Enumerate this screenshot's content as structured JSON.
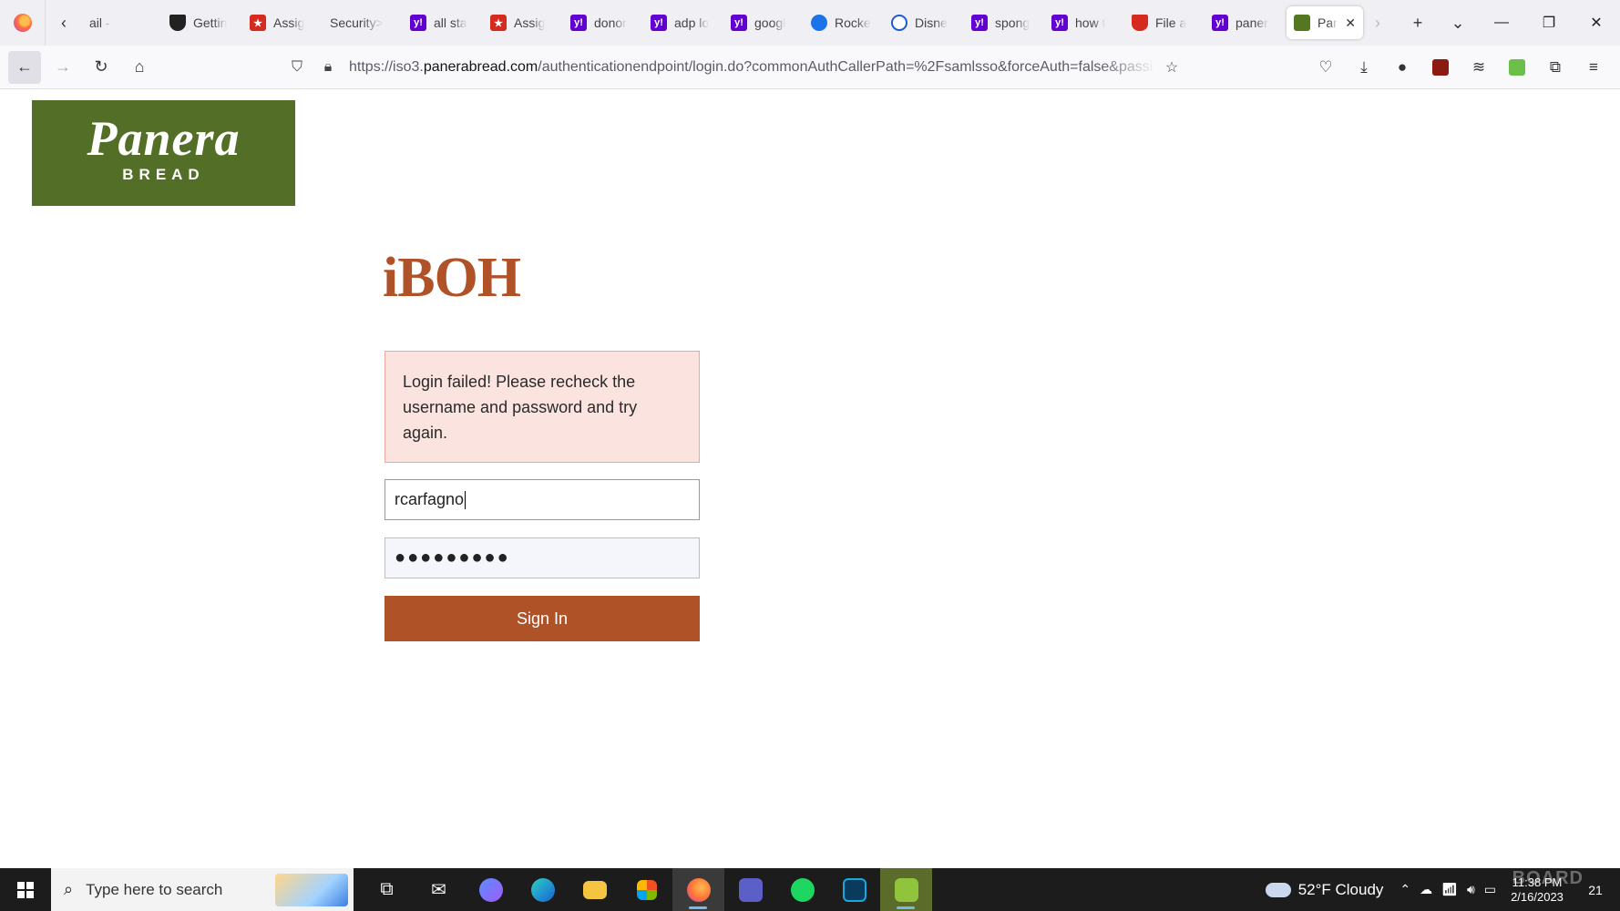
{
  "browser": {
    "tabs": [
      {
        "title": "ail -",
        "favicon": "none-icon"
      },
      {
        "title": "Gettin",
        "favicon": "shield-icon"
      },
      {
        "title": "Assig",
        "favicon": "assign-icon"
      },
      {
        "title": "Security>",
        "favicon": "none-icon"
      },
      {
        "title": "all sta",
        "favicon": "yahoo-icon"
      },
      {
        "title": "Assig",
        "favicon": "assign-icon"
      },
      {
        "title": "donor",
        "favicon": "yahoo-icon"
      },
      {
        "title": "adp lo",
        "favicon": "yahoo-icon"
      },
      {
        "title": "googl",
        "favicon": "yahoo-icon"
      },
      {
        "title": "Rocke",
        "favicon": "rocket-icon"
      },
      {
        "title": "Disne",
        "favicon": "disney-icon"
      },
      {
        "title": "spong",
        "favicon": "yahoo-icon"
      },
      {
        "title": "how t",
        "favicon": "yahoo-icon"
      },
      {
        "title": "File a",
        "favicon": "file-icon"
      },
      {
        "title": "paner",
        "favicon": "yahoo-icon"
      }
    ],
    "active_tab": {
      "title": "Pan",
      "favicon": "panera-icon"
    },
    "url": {
      "prefix": "https://iso3.",
      "domain": "panerabread.com",
      "path": "/authenticationendpoint/login.do?commonAuthCallerPath=%2Fsamlsso&forceAuth=false&passi"
    }
  },
  "page": {
    "logo": {
      "line1": "Panera",
      "line2": "BREAD"
    },
    "brand_title": "iBOH",
    "error_message": "Login failed! Please recheck the username and password and try again.",
    "username_value": "rcarfagno",
    "password_masked": "●●●●●●●●●",
    "signin_label": "Sign In"
  },
  "taskbar": {
    "search_placeholder": "Type here to search",
    "weather": "52°F  Cloudy",
    "time": "11:38 PM",
    "date": "2/16/2023",
    "notification_count": "21",
    "watermark": "BOARD"
  },
  "colors": {
    "panera_green": "#536f27",
    "accent_brown": "#b05228",
    "error_bg": "#fbe4df",
    "error_border": "#eba99d"
  }
}
